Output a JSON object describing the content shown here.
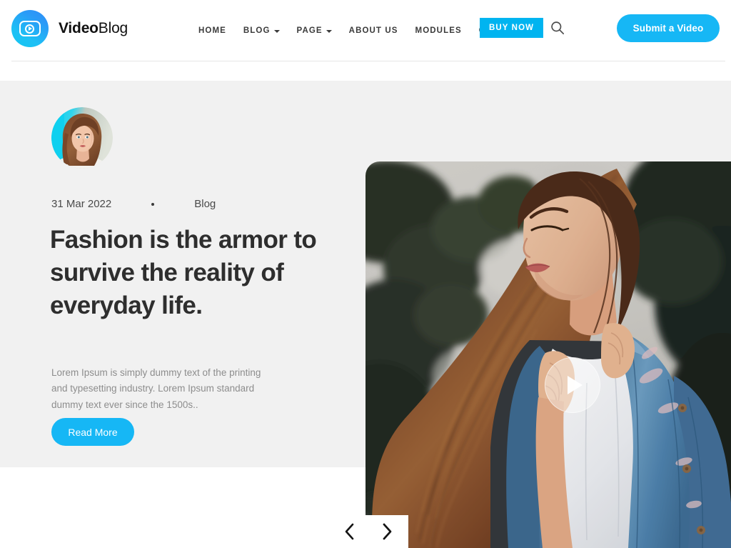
{
  "site": {
    "logo_icon": "video-play-circle-icon",
    "brand_bold": "Video",
    "brand_light": "Blog"
  },
  "nav": {
    "items": [
      {
        "label": "HOME",
        "has_dropdown": false
      },
      {
        "label": "BLOG",
        "has_dropdown": true
      },
      {
        "label": "PAGE",
        "has_dropdown": true
      },
      {
        "label": "ABOUT US",
        "has_dropdown": false
      },
      {
        "label": "MODULES",
        "has_dropdown": false
      },
      {
        "label": "CONTACT",
        "has_dropdown": false
      }
    ],
    "buy_now_label": "BUY NOW",
    "search_icon": "search-icon",
    "submit_label": "Submit a Video"
  },
  "hero": {
    "avatar_alt": "author-avatar",
    "date": "31 Mar 2022",
    "separator": "•",
    "category": "Blog",
    "headline": "Fashion is the armor to survive the reality of everyday life.",
    "body": "Lorem Ipsum is simply dummy text of the printing and typesetting industry. Lorem Ipsum standard dummy text ever since the 1500s..",
    "read_more_label": "Read More",
    "prev_icon": "chevron-left-icon",
    "next_icon": "chevron-right-icon",
    "play_icon": "play-icon",
    "media_alt": "woman-with-long-hair-in-denim-jacket"
  },
  "colors": {
    "accent": "#16b7f5",
    "accent_flat": "#00b4f0",
    "hero_bg": "#f1f1f1",
    "heading": "#2e2e2e",
    "body_text": "#8d8d8d",
    "nav_text": "#3a3a3a",
    "divider": "#e6e6e6"
  }
}
